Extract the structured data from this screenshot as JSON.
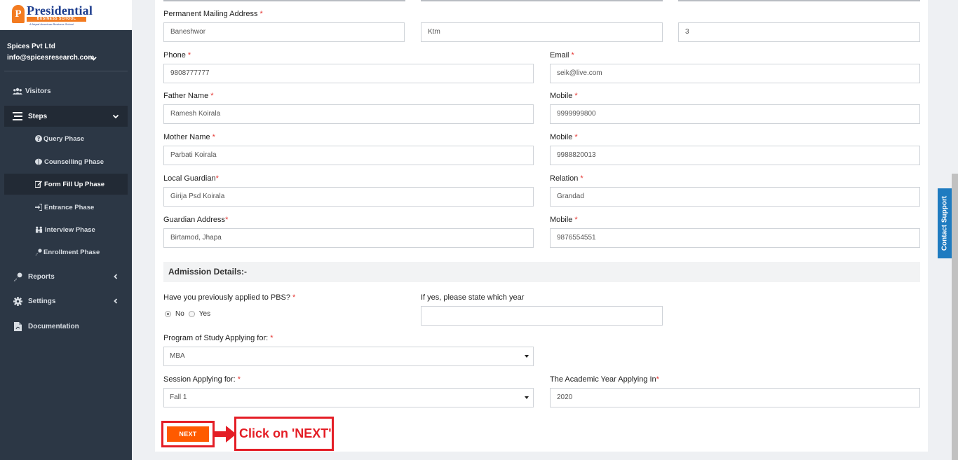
{
  "brand": {
    "logo_title": "Presidential",
    "logo_subtitle": "BUSINESS SCHOOL",
    "logo_tagline": "A Nepal-American Business School",
    "logo_letter": "P"
  },
  "profile": {
    "company": "Spices Pvt Ltd",
    "email": "info@spicesresearch.com"
  },
  "sidebar": {
    "items": [
      {
        "label": "Visitors"
      },
      {
        "label": "Steps"
      },
      {
        "label": "Query Phase"
      },
      {
        "label": "Counselling Phase"
      },
      {
        "label": "Form Fill Up Phase"
      },
      {
        "label": "Entrance Phase"
      },
      {
        "label": "Interview Phase"
      },
      {
        "label": "Enrollment Phase"
      },
      {
        "label": "Reports"
      },
      {
        "label": "Settings"
      },
      {
        "label": "Documentation"
      }
    ],
    "active_item": "Form Fill Up Phase"
  },
  "form": {
    "mailing_address": {
      "label": "Permanent Mailing Address",
      "values": [
        "Baneshwor",
        "Ktm",
        "3"
      ]
    },
    "phone": {
      "label": "Phone",
      "value": "9808777777"
    },
    "email": {
      "label": "Email",
      "value": "seik@live.com"
    },
    "father_name": {
      "label": "Father Name",
      "value": "Ramesh Koirala"
    },
    "father_mobile": {
      "label": "Mobile",
      "value": "9999999800"
    },
    "mother_name": {
      "label": "Mother Name",
      "value": "Parbati Koirala"
    },
    "mother_mobile": {
      "label": "Mobile",
      "value": "9988820013"
    },
    "local_guardian": {
      "label": "Local Guardian",
      "value": "Girija Psd Koirala"
    },
    "relation": {
      "label": "Relation",
      "value": "Grandad"
    },
    "guardian_address": {
      "label": "Guardian Address",
      "value": "Birtamod, Jhapa"
    },
    "guardian_mobile": {
      "label": "Mobile",
      "value": "9876554551"
    },
    "required_marker": "*"
  },
  "admission": {
    "section_title": "Admission Details:-",
    "previously_applied": {
      "label": "Have you previously applied to PBS?",
      "options": [
        "No",
        "Yes"
      ],
      "selected": "No"
    },
    "applied_year": {
      "label": "If yes, please state which year",
      "value": ""
    },
    "program": {
      "label": "Program of Study Applying for:",
      "value": "MBA"
    },
    "session": {
      "label": "Session Applying for:",
      "value": "Fall 1"
    },
    "academic_year": {
      "label": "The Academic Year Applying In",
      "value": "2020"
    }
  },
  "actions": {
    "next_label": "NEXT",
    "callout_text": "Click on 'NEXT'"
  },
  "contact_support": "Contact Support",
  "colors": {
    "sidebar_bg": "#2c3745",
    "next_button": "#ff5a00",
    "annotation_red": "#e41e26",
    "contact_tab": "#1e7bc0",
    "required": "#e53935"
  }
}
